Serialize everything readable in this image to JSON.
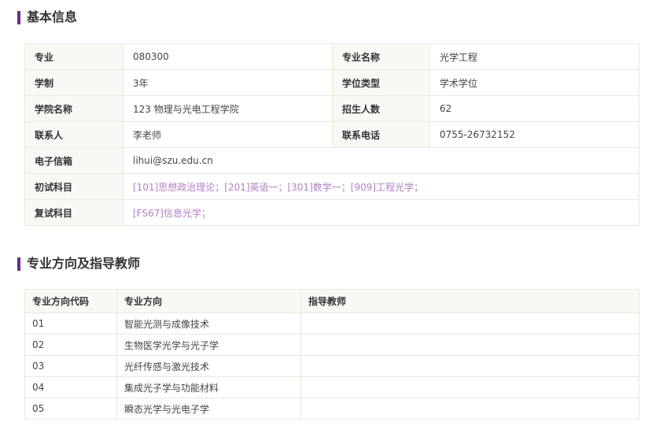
{
  "basic": {
    "title": "基本信息",
    "rows": [
      {
        "label1": "专业",
        "value1": "080300",
        "label2": "专业名称",
        "value2": "光学工程"
      },
      {
        "label1": "学制",
        "value1": "3年",
        "label2": "学位类型",
        "value2": "学术学位"
      },
      {
        "label1": "学院名称",
        "value1": "123 物理与光电工程学院",
        "label2": "招生人数",
        "value2": "62"
      },
      {
        "label1": "联系人",
        "value1": "李老师",
        "label2": "联系电话",
        "value2": "0755-26732152"
      }
    ],
    "email": {
      "label": "电子信箱",
      "value": "lihui@szu.edu.cn"
    },
    "initial_exam": {
      "label": "初试科目",
      "value": "[101]思想政治理论；[201]英语一；[301]数学一；[909]工程光学；"
    },
    "retest": {
      "label": "复试科目",
      "value": "[FS67]信息光学；"
    },
    "colors": {
      "accent": "#6b2c91",
      "link": "#b47fc4",
      "label_bg": "#faf8f5",
      "border": "#ece7e1"
    }
  },
  "directions": {
    "title": "专业方向及指导教师",
    "headers": [
      "专业方向代码",
      "专业方向",
      "指导教师"
    ],
    "rows": [
      {
        "code": "01",
        "name": "智能光测与成像技术",
        "advisor": ""
      },
      {
        "code": "02",
        "name": "生物医学光学与光子学",
        "advisor": ""
      },
      {
        "code": "03",
        "name": "光纤传感与激光技术",
        "advisor": ""
      },
      {
        "code": "04",
        "name": "集成光子学与功能材料",
        "advisor": ""
      },
      {
        "code": "05",
        "name": "瞬态光学与光电子学",
        "advisor": ""
      }
    ]
  }
}
